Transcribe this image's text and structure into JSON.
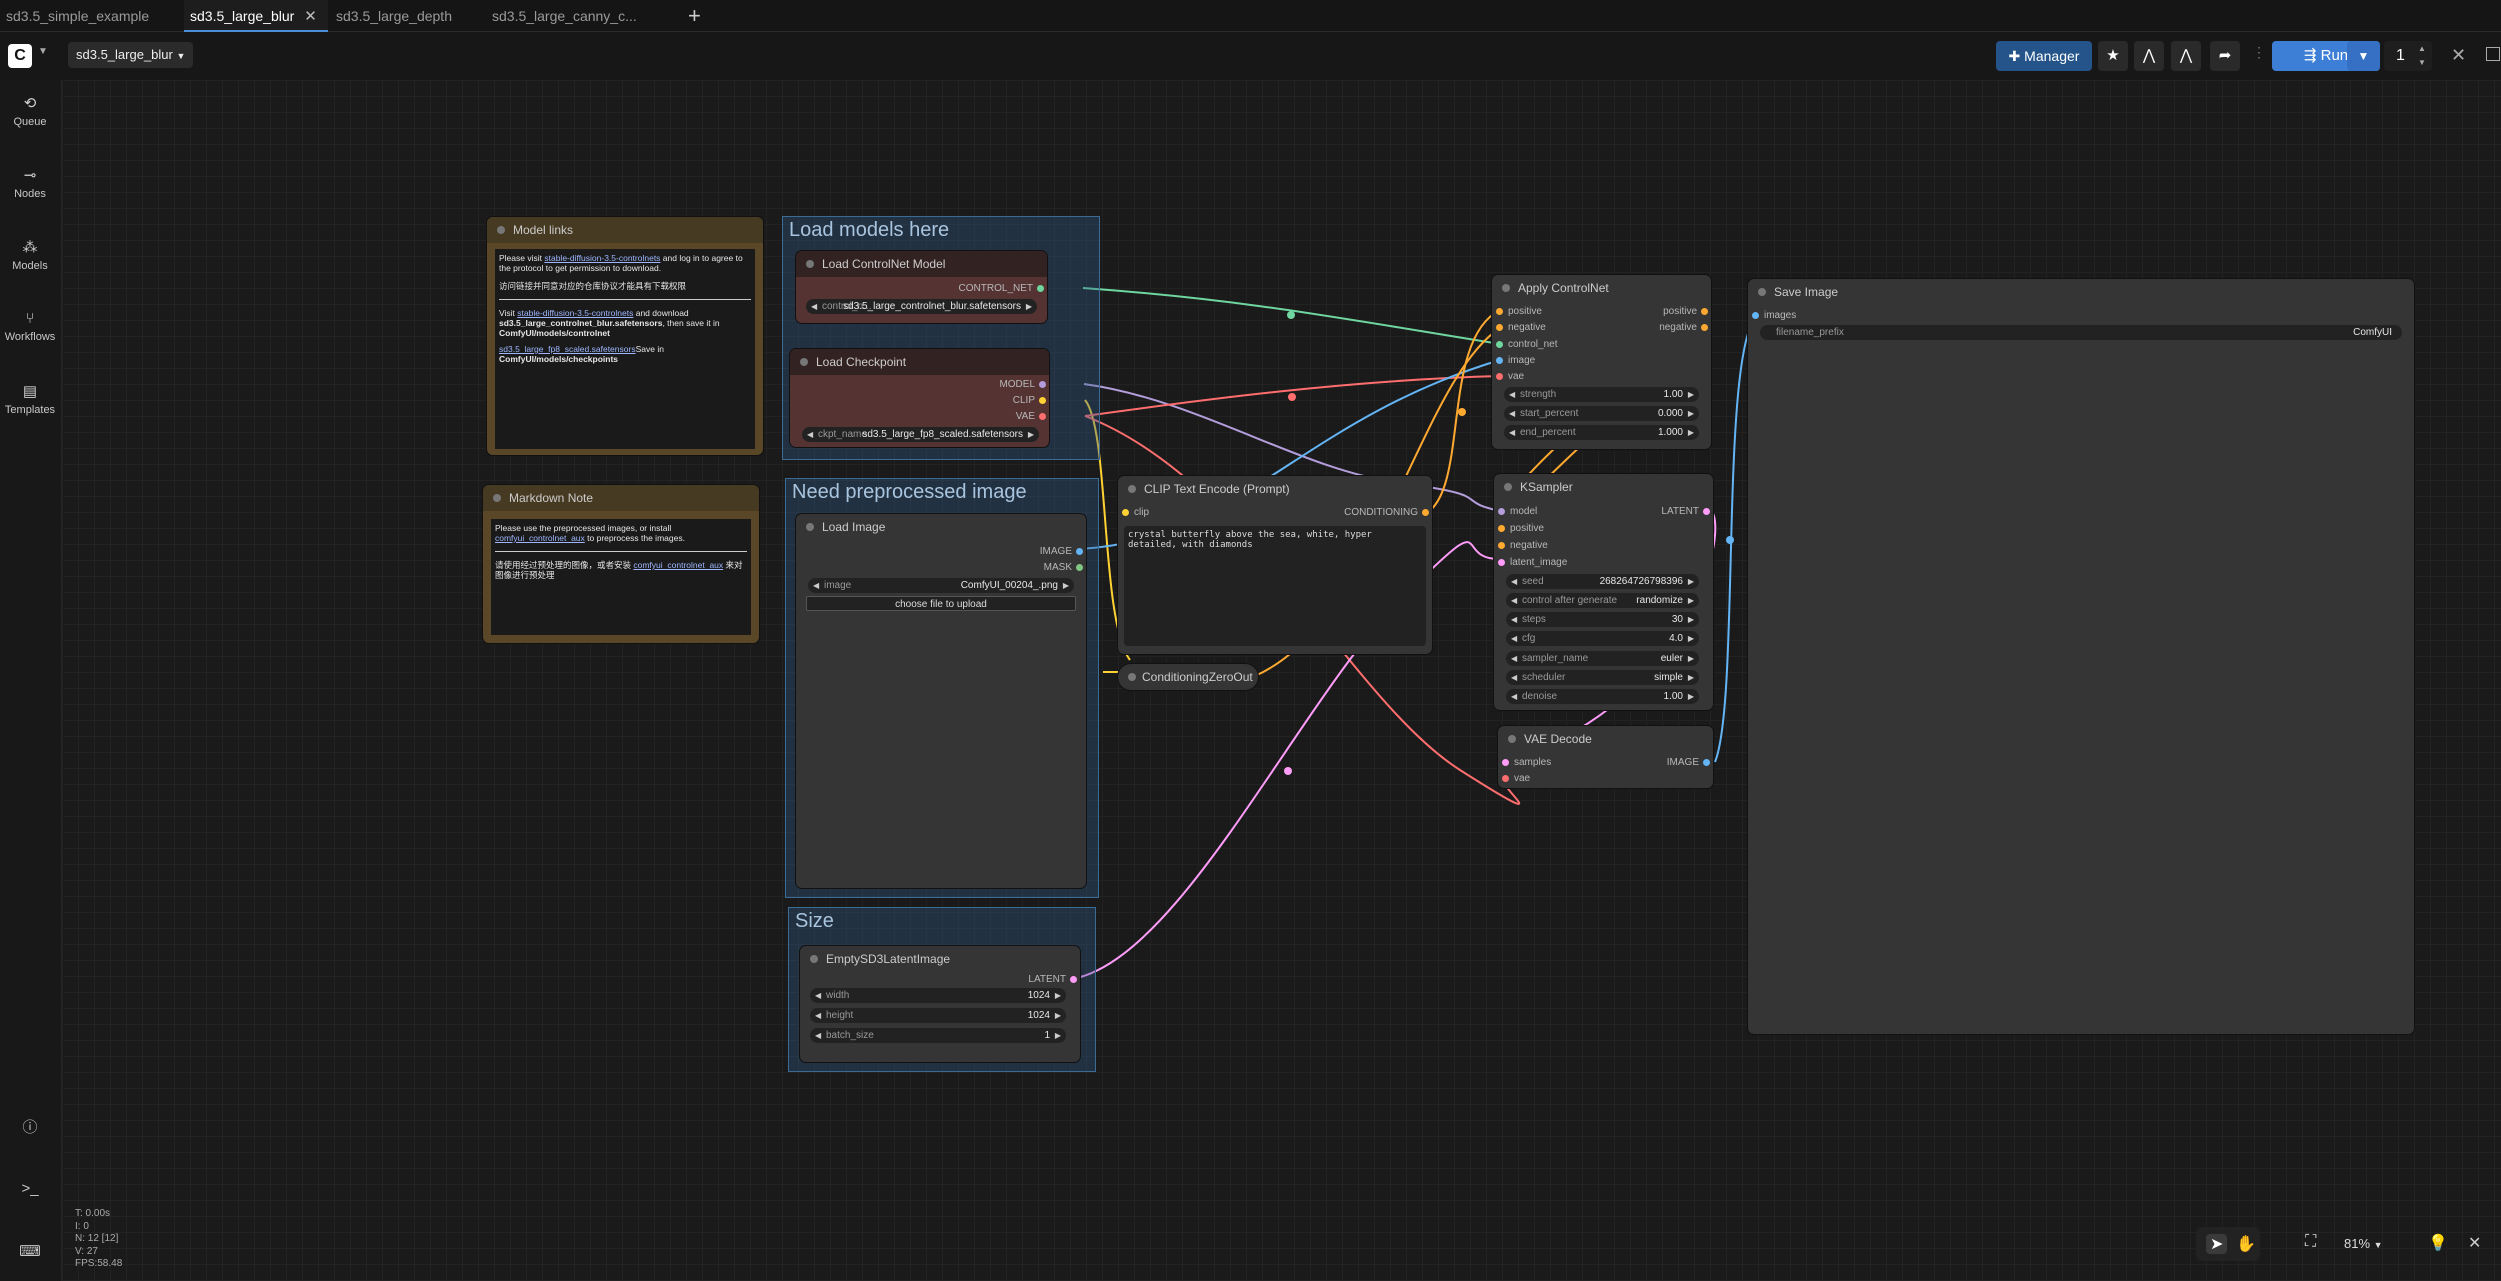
{
  "tabs": [
    {
      "label": "sd3.5_simple_example",
      "active": false
    },
    {
      "label": "sd3.5_large_blur",
      "active": true
    },
    {
      "label": "sd3.5_large_depth",
      "active": false
    },
    {
      "label": "sd3.5_large_canny_c...",
      "active": false
    }
  ],
  "toolbar": {
    "workflow_name": "sd3.5_large_blur",
    "manager_label": "Manager",
    "run_label": "Run",
    "run_count": "1"
  },
  "sidebar": {
    "items": [
      {
        "label": "Queue",
        "icon": "history-icon"
      },
      {
        "label": "Nodes",
        "icon": "nodes-icon"
      },
      {
        "label": "Models",
        "icon": "models-icon"
      },
      {
        "label": "Workflows",
        "icon": "workflows-icon"
      },
      {
        "label": "Templates",
        "icon": "templates-icon"
      }
    ]
  },
  "groups": {
    "load_models": "Load models here",
    "preprocessed": "Need preprocessed image",
    "size": "Size"
  },
  "nodes": {
    "model_links": {
      "title": "Model links",
      "line1_pre": "Please visit ",
      "line1_link": "stable-diffusion-3.5-controlnets",
      "line1_post": " and log in to agree to the protocol to get permission to download.",
      "line2": "访问链接并同意对应的仓库协议才能具有下载权限",
      "line3_pre": "Visit ",
      "line3_link": "stable-diffusion-3.5-controlnets",
      "line3_post": " and download",
      "line3_file": "sd3.5_large_controlnet_blur.safetensors",
      "line3_then": ", then save it in",
      "line3_path": "ComfyUI/models/controlnet",
      "line4_link": "sd3.5_large_fp8_scaled.safetensors",
      "line4_post": "Save in",
      "line4_path": "ComfyUI/models/checkpoints"
    },
    "markdown_note": {
      "title": "Markdown Note",
      "line1": "Please use the preprocessed images, or install",
      "line1_link": "comfyui_controlnet_aux",
      "line1_post": " to preprocess the images.",
      "line2_pre": "请使用经过预处理的图像，或者安装 ",
      "line2_link": "comfyui_controlnet_aux",
      "line2_post": " 来对图像进行预处理"
    },
    "load_controlnet": {
      "title": "Load ControlNet Model",
      "out": "CONTROL_NET",
      "w_label": "control_n...",
      "w_value": "sd3.5_large_controlnet_blur.safetensors"
    },
    "load_checkpoint": {
      "title": "Load Checkpoint",
      "out_model": "MODEL",
      "out_clip": "CLIP",
      "out_vae": "VAE",
      "w_label": "ckpt_name",
      "w_value": "sd3.5_large_fp8_scaled.safetensors"
    },
    "load_image": {
      "title": "Load Image",
      "out_image": "IMAGE",
      "out_mask": "MASK",
      "w_label": "image",
      "w_value": "ComfyUI_00204_.png",
      "upload": "choose file to upload"
    },
    "empty_latent": {
      "title": "EmptySD3LatentImage",
      "out": "LATENT",
      "width_label": "width",
      "width": "1024",
      "height_label": "height",
      "height": "1024",
      "batch_label": "batch_size",
      "batch": "1"
    },
    "clip_encode": {
      "title": "CLIP Text Encode (Prompt)",
      "in": "clip",
      "out": "CONDITIONING",
      "text": "crystal butterfly above the sea, white, hyper detailed, with diamonds"
    },
    "cond_zero": {
      "title": "ConditioningZeroOut"
    },
    "apply_controlnet": {
      "title": "Apply ControlNet",
      "inputs": [
        "positive",
        "negative",
        "control_net",
        "image",
        "vae"
      ],
      "outputs": [
        "positive",
        "negative"
      ],
      "strength_label": "strength",
      "strength": "1.00",
      "start_label": "start_percent",
      "start": "0.000",
      "end_label": "end_percent",
      "end": "1.000"
    },
    "ksampler": {
      "title": "KSampler",
      "inputs": [
        "model",
        "positive",
        "negative",
        "latent_image"
      ],
      "out": "LATENT",
      "widgets": [
        {
          "label": "seed",
          "value": "268264726798396"
        },
        {
          "label": "control after generate",
          "value": "randomize"
        },
        {
          "label": "steps",
          "value": "30"
        },
        {
          "label": "cfg",
          "value": "4.0"
        },
        {
          "label": "sampler_name",
          "value": "euler"
        },
        {
          "label": "scheduler",
          "value": "simple"
        },
        {
          "label": "denoise",
          "value": "1.00"
        }
      ]
    },
    "vae_decode": {
      "title": "VAE Decode",
      "in_samples": "samples",
      "in_vae": "vae",
      "out": "IMAGE"
    },
    "save_image": {
      "title": "Save Image",
      "in": "images",
      "w_label": "filename_prefix",
      "w_value": "ComfyUI"
    }
  },
  "stats": {
    "t": "T: 0.00s",
    "i": "I: 0",
    "n": "N: 12 [12]",
    "v": "V: 27",
    "fps": "FPS:58.48"
  },
  "zoom": "81%",
  "colors": {
    "accent": "#4a8fd8",
    "run": "#3d7fd6",
    "control_net_wire": "#6fd6a0",
    "model_wire": "#b39ddb",
    "clip_wire": "#ffd233",
    "vae_wire": "#ff6e6e",
    "image_wire": "#64b5f6",
    "latent_wire": "#ff9cf9",
    "cond_wire": "#ffa931"
  }
}
